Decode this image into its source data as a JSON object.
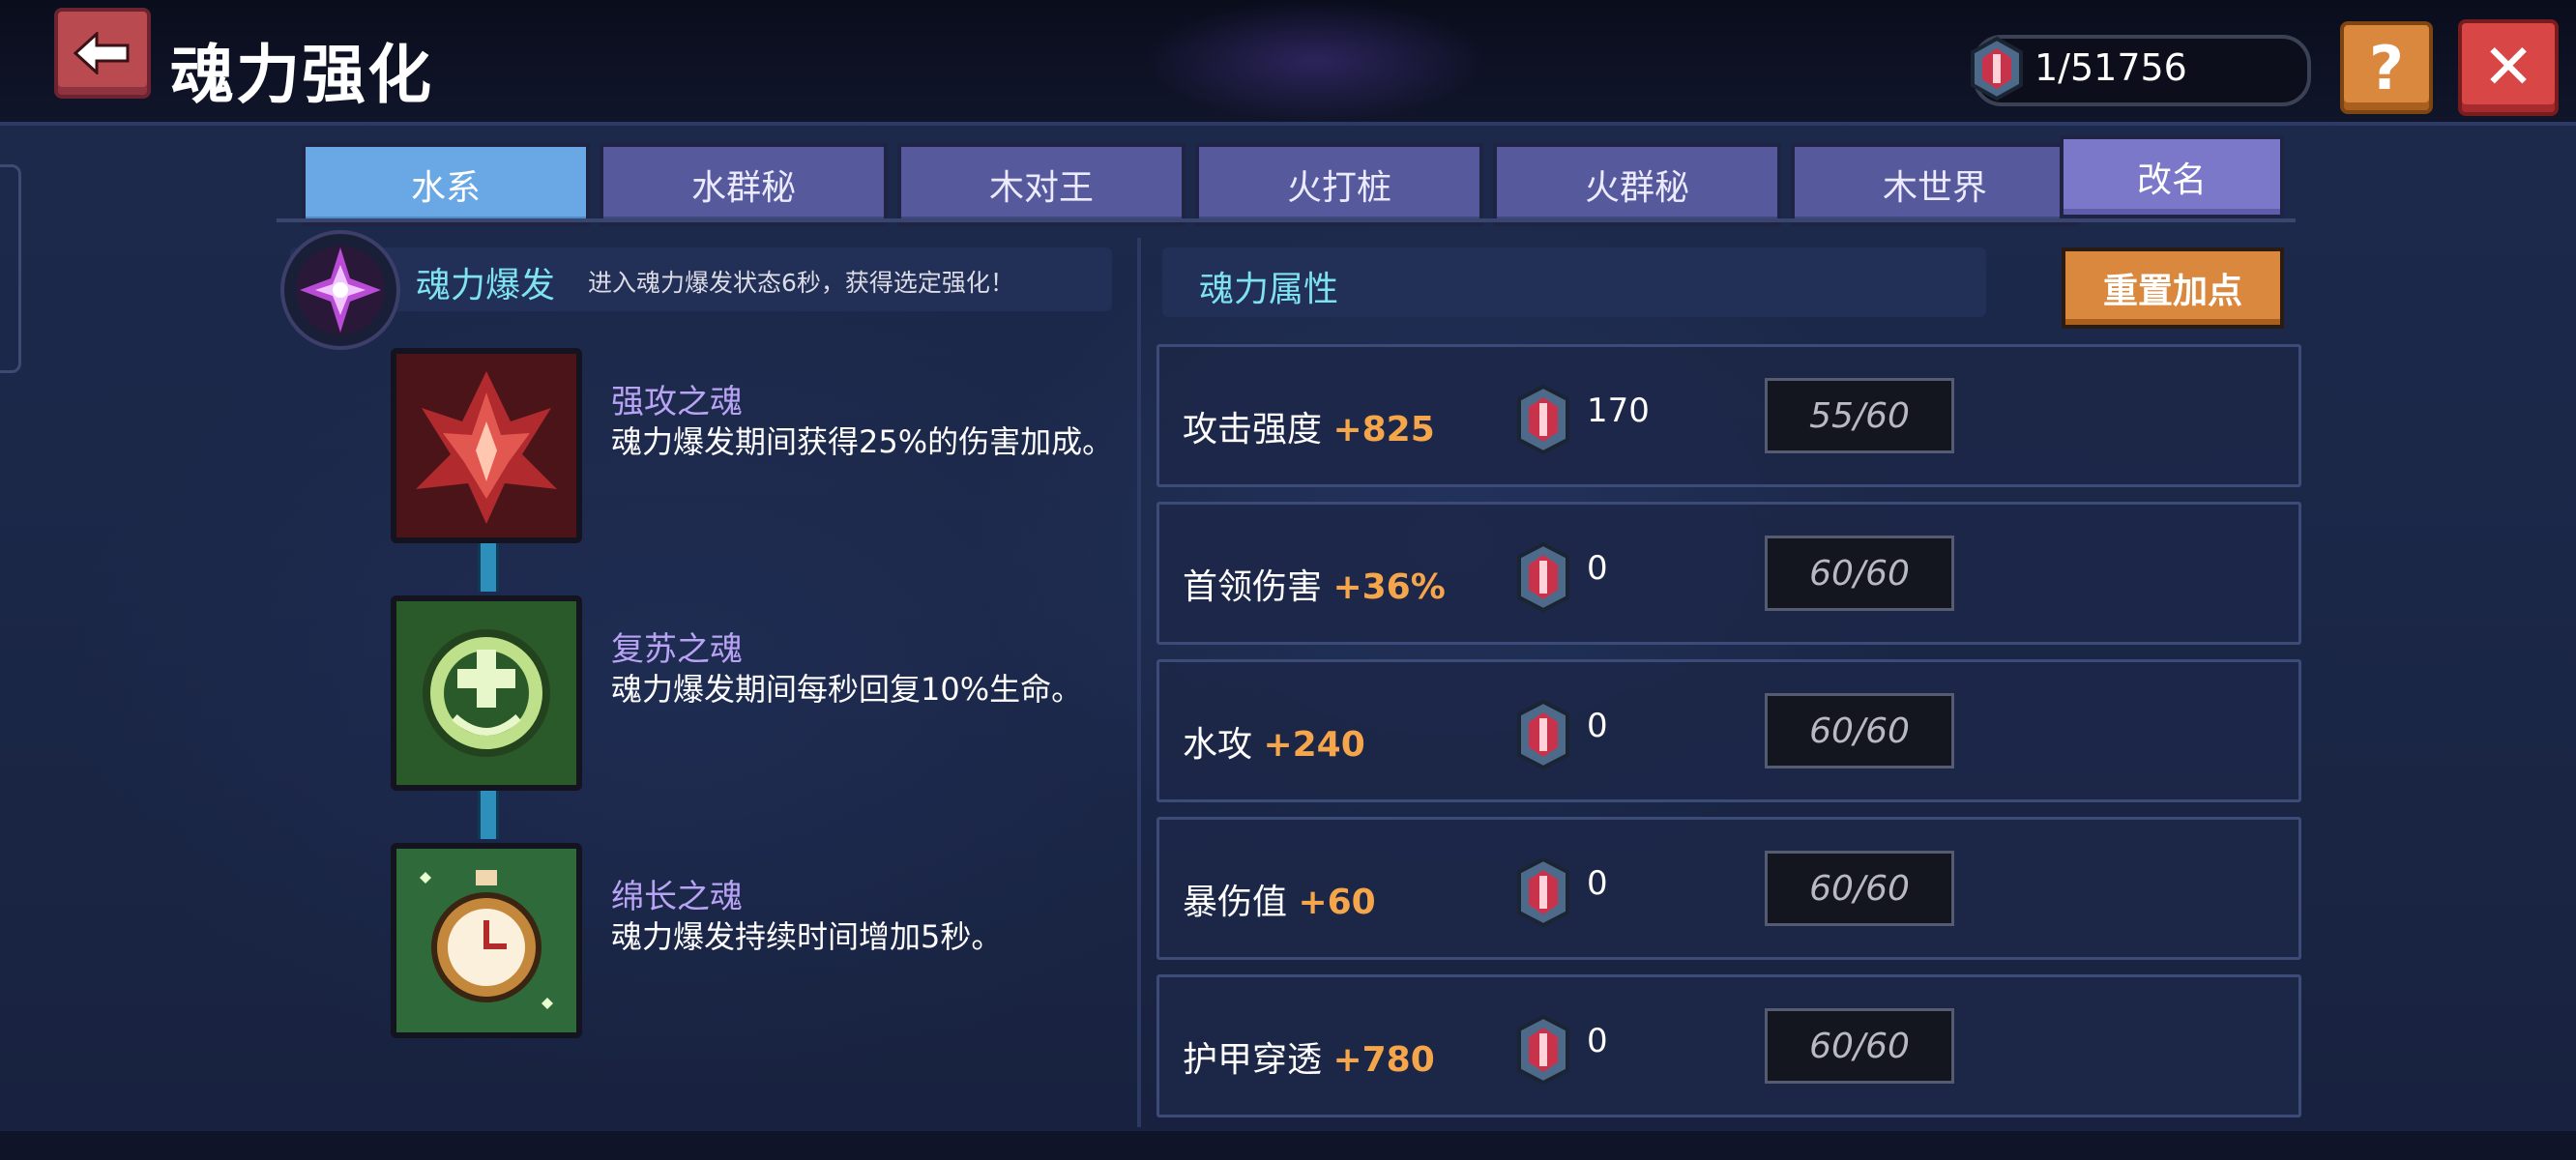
{
  "header": {
    "title": "魂力强化",
    "currency_value": "1/51756",
    "help_label": "?",
    "close_label": "✕"
  },
  "tabs": [
    {
      "label": "水系",
      "active": true
    },
    {
      "label": "水群秘",
      "active": false
    },
    {
      "label": "木对王",
      "active": false
    },
    {
      "label": "火打桩",
      "active": false
    },
    {
      "label": "火群秘",
      "active": false
    },
    {
      "label": "木世界",
      "active": false
    }
  ],
  "rename_label": "改名",
  "soul_burst": {
    "title": "魂力爆发",
    "description": "进入魂力爆发状态6秒，获得选定强化！"
  },
  "skills": [
    {
      "name": "强攻之魂",
      "description": "魂力爆发期间获得25%的伤害加成。",
      "icon": "red-flame-soul-icon"
    },
    {
      "name": "复苏之魂",
      "description": "魂力爆发期间每秒回复10%生命。",
      "icon": "green-heal-soul-icon"
    },
    {
      "name": "绵长之魂",
      "description": "魂力爆发持续时间增加5秒。",
      "icon": "stopwatch-soul-icon"
    }
  ],
  "attributes_panel": {
    "title": "魂力属性",
    "reset_label": "重置加点"
  },
  "attributes": [
    {
      "name": "攻击强度",
      "bonus": "+825",
      "cost": "170",
      "level": "55/60"
    },
    {
      "name": "首领伤害",
      "bonus": "+36%",
      "cost": "0",
      "level": "60/60"
    },
    {
      "name": "水攻",
      "bonus": "+240",
      "cost": "0",
      "level": "60/60"
    },
    {
      "name": "暴伤值",
      "bonus": "+60",
      "cost": "0",
      "level": "60/60"
    },
    {
      "name": "护甲穿透",
      "bonus": "+780",
      "cost": "0",
      "level": "60/60"
    }
  ],
  "colors": {
    "accent_cyan": "#7ee3ef",
    "skill_name_purple": "#b9a3f4",
    "bonus_orange": "#f5a64a",
    "tab_active": "#69a8e4",
    "tab_inactive": "#565a9c"
  }
}
